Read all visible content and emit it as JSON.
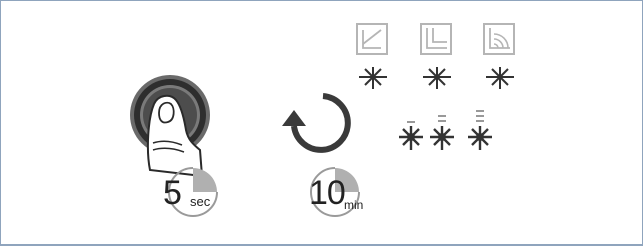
{
  "colors": {
    "border": "#8fa4bd",
    "ring_outer": "#9a9a9a",
    "ring_dark": "#4a4a4a",
    "icon_gray": "#b5b5b5",
    "star_dark": "#333333",
    "timer_fill": "#b0b0b0",
    "arrow": "#3a3a3a"
  },
  "timer_5": {
    "number": "5",
    "unit": "sec"
  },
  "timer_10": {
    "number": "10",
    "unit": "min"
  },
  "icons": {
    "button": "push-button-icon",
    "finger": "finger-press-icon",
    "reset": "circular-arrow-icon",
    "modes": [
      "slope-mode-icon",
      "step-mode-icon",
      "wave-mode-icon"
    ],
    "indicators": [
      "led-level-1-icon",
      "led-level-2-icon",
      "led-level-3-icon"
    ]
  }
}
